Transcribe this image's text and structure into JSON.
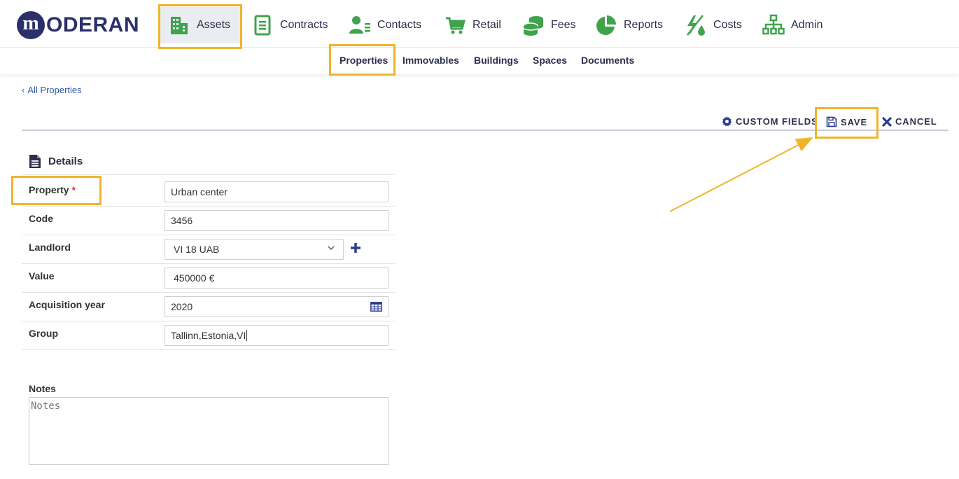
{
  "brand": {
    "logo_letter": "m",
    "logo_text": "ODERAN"
  },
  "nav": {
    "assets": "Assets",
    "contracts": "Contracts",
    "contacts": "Contacts",
    "retail": "Retail",
    "fees": "Fees",
    "reports": "Reports",
    "costs": "Costs",
    "admin": "Admin"
  },
  "subnav": {
    "properties": "Properties",
    "immovables": "Immovables",
    "buildings": "Buildings",
    "spaces": "Spaces",
    "documents": "Documents"
  },
  "back_link": "All Properties",
  "actions": {
    "custom_fields": "CUSTOM FIELDS",
    "save": "SAVE",
    "cancel": "CANCEL"
  },
  "details": {
    "title": "Details",
    "property": {
      "label": "Property",
      "required": "*",
      "value": "Urban center"
    },
    "code": {
      "label": "Code",
      "value": "3456"
    },
    "landlord": {
      "label": "Landlord",
      "value": "VI 18 UAB"
    },
    "value": {
      "label": "Value",
      "value": "450000 €"
    },
    "acquisition_year": {
      "label": "Acquisition year",
      "value": "2020"
    },
    "group": {
      "label": "Group",
      "value": "Tallinn,Estonia,VI"
    }
  },
  "notes": {
    "label": "Notes",
    "placeholder": "Notes"
  },
  "colors": {
    "brand": "#2b2f6b",
    "nav_icon": "#3fa34d",
    "highlight": "#f0b429",
    "link": "#2f58a8",
    "action": "#2b3a8f"
  }
}
